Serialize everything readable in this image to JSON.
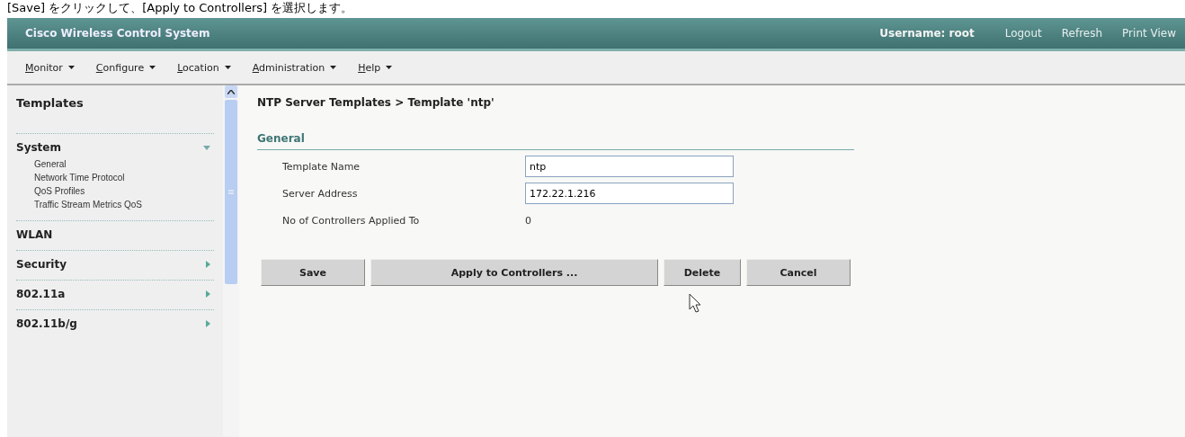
{
  "caption": "[Save] をクリックして、[Apply to Controllers] を選択します。",
  "header": {
    "title": "Cisco Wireless Control System",
    "username_label": "Username:",
    "username": "root",
    "links": [
      "Logout",
      "Refresh",
      "Print View"
    ]
  },
  "menu": [
    "Monitor",
    "Configure",
    "Location",
    "Administration",
    "Help"
  ],
  "sidebar": {
    "title": "Templates",
    "sections": [
      {
        "label": "System",
        "kind": "expanded",
        "children": [
          "General",
          "Network Time Protocol",
          "QoS Profiles",
          "Traffic Stream Metrics QoS"
        ]
      },
      {
        "label": "WLAN",
        "kind": "plain"
      },
      {
        "label": "Security",
        "kind": "collapsed"
      },
      {
        "label": "802.11a",
        "kind": "collapsed"
      },
      {
        "label": "802.11b/g",
        "kind": "collapsed"
      }
    ]
  },
  "content": {
    "breadcrumb": "NTP Server Templates > Template 'ntp'",
    "section": "General",
    "fields": [
      {
        "label": "Template Name",
        "kind": "input",
        "value": "ntp"
      },
      {
        "label": "Server Address",
        "kind": "input",
        "value": "172.22.1.216"
      },
      {
        "label": "No of Controllers Applied To",
        "kind": "text",
        "value": "0"
      }
    ],
    "buttons": [
      "Save",
      "Apply to Controllers ...",
      "Delete",
      "Cancel"
    ]
  }
}
